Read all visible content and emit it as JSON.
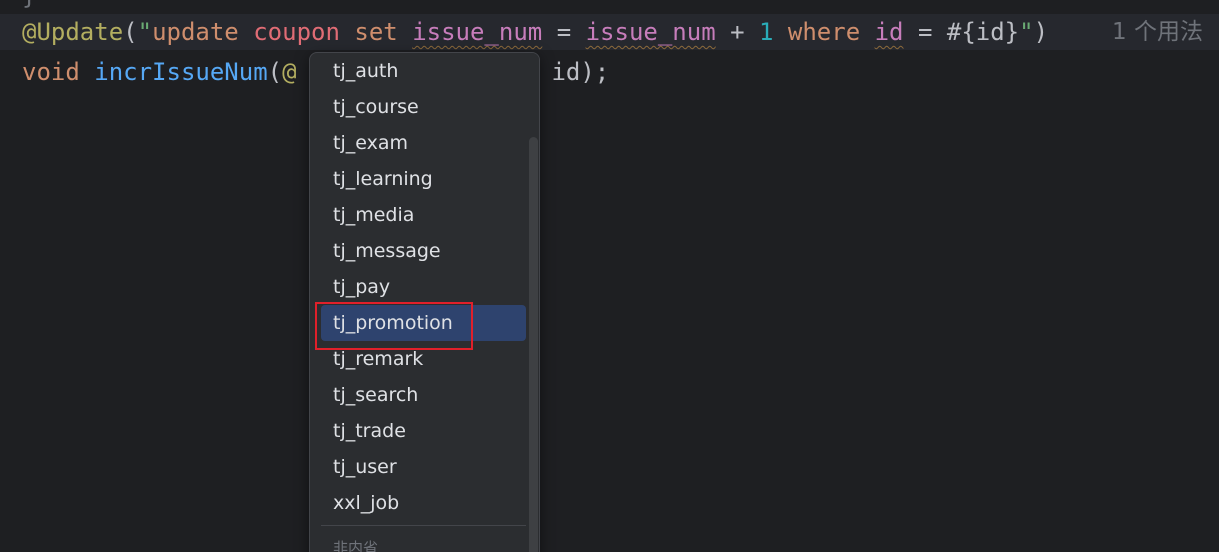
{
  "editor": {
    "prev_line_fragment": "}",
    "line1": {
      "annotation": "@Update",
      "open_paren": "(",
      "quote_open": "\"",
      "kw_update": "update",
      "table": "coupon",
      "kw_set": "set",
      "col1": "issue_num",
      "eq1": "=",
      "col2": "issue_num",
      "plus": "+",
      "num": "1",
      "kw_where": "where",
      "col3": "id",
      "eq2": "=",
      "placeholder": "#{id}",
      "quote_close": "\"",
      "close_paren": ")",
      "usage_hint": "1 个用法"
    },
    "line2": {
      "kw_void": "void",
      "method": "incrIssueNum",
      "paren_open": "(",
      "at": "@",
      "tail": "g id);"
    }
  },
  "completion_popup": {
    "items": [
      {
        "label": "tj_auth"
      },
      {
        "label": "tj_course"
      },
      {
        "label": "tj_exam"
      },
      {
        "label": "tj_learning"
      },
      {
        "label": "tj_media"
      },
      {
        "label": "tj_message"
      },
      {
        "label": "tj_pay"
      },
      {
        "label": "tj_promotion",
        "selected": true
      },
      {
        "label": "tj_remark"
      },
      {
        "label": "tj_search"
      },
      {
        "label": "tj_trade"
      },
      {
        "label": "tj_user"
      },
      {
        "label": "xxl_job"
      }
    ],
    "group_label": "非内省"
  },
  "colors": {
    "background": "#1e1f22",
    "popup_background": "#2b2d30",
    "selection": "#2e436e",
    "highlight_box": "#e0202a"
  }
}
